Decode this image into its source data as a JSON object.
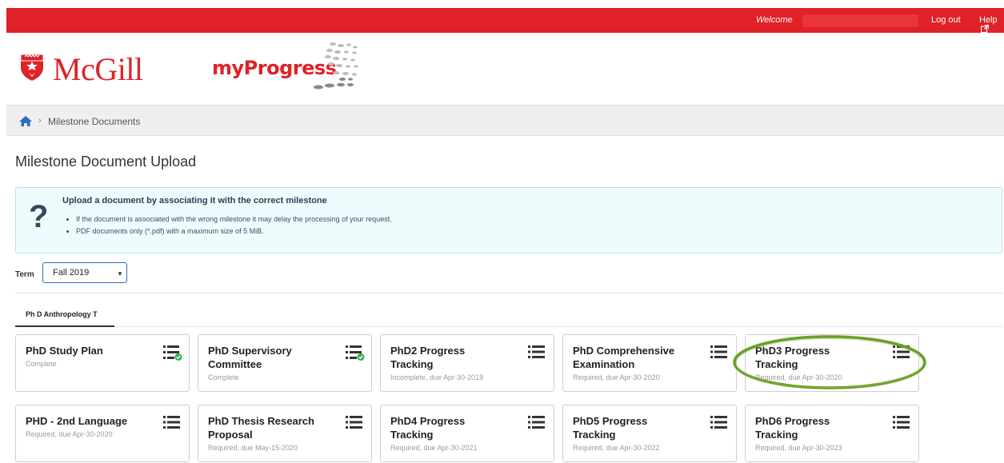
{
  "topbar": {
    "welcome": "Welcome",
    "logout": "Log out",
    "help": "Help"
  },
  "header": {
    "logo": "McGill",
    "app_name": "myProgress"
  },
  "breadcrumb": {
    "current": "Milestone Documents"
  },
  "page": {
    "title": "Milestone Document Upload"
  },
  "info": {
    "title": "Upload a document by associating it with the correct milestone",
    "bullets": [
      "If the document is associated with the wrong milestone it may delay the processing of your request.",
      "PDF documents only (*.pdf) with a maximum size of 5 MiB."
    ]
  },
  "term": {
    "label": "Term",
    "selected": "Fall 2019"
  },
  "tabs": [
    {
      "label": "Ph D Anthropology T"
    }
  ],
  "milestones": [
    {
      "title": "PhD Study Plan",
      "status": "Complete",
      "icon": "list-check-icon"
    },
    {
      "title": "PhD Supervisory Committee",
      "status": "Complete",
      "icon": "list-check-icon"
    },
    {
      "title": "PhD2 Progress Tracking",
      "status": "Incomplete, due Apr-30-2019",
      "icon": "list-icon"
    },
    {
      "title": "PhD Comprehensive Examination",
      "status": "Required, due Apr-30-2020",
      "icon": "list-icon"
    },
    {
      "title": "PhD3 Progress Tracking",
      "status": "Required, due Apr-30-2020",
      "icon": "list-icon"
    },
    {
      "title": "PHD - 2nd Language",
      "status": "Required, due Apr-30-2020",
      "icon": "list-icon"
    },
    {
      "title": "PhD Thesis Research Proposal",
      "status": "Required, due May-15-2020",
      "icon": "list-icon"
    },
    {
      "title": "PhD4 Progress Tracking",
      "status": "Required, due Apr-30-2021",
      "icon": "list-icon"
    },
    {
      "title": "PhD5 Progress Tracking",
      "status": "Required, due Apr-30-2022",
      "icon": "list-icon"
    },
    {
      "title": "PhD6 Progress Tracking",
      "status": "Required, due Apr-30-2023",
      "icon": "list-icon"
    }
  ],
  "colors": {
    "brand_red": "#e02127",
    "highlight_green": "#6a9f2a",
    "check_green": "#2fae4a"
  }
}
